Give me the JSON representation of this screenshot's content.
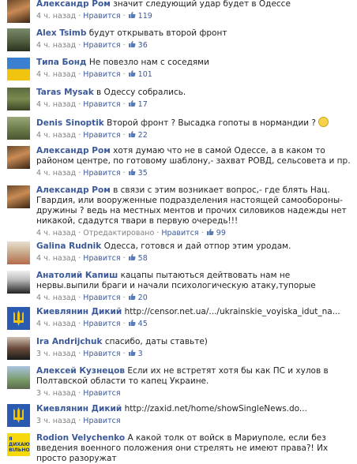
{
  "comments": [
    {
      "name": "Александр Ром",
      "text": "значит следующий удар будет в Одессе",
      "time": "4 ч. назад",
      "like": "Нравится",
      "count": "119"
    },
    {
      "name": "Alex Tsimb",
      "text": "будут открывать второй фронт",
      "time": "4 ч. назад",
      "like": "Нравится",
      "count": "36"
    },
    {
      "name": "Типа Бонд",
      "text": "Не повезло нам с соседями",
      "time": "4 ч. назад",
      "like": "Нравится",
      "count": "101"
    },
    {
      "name": "Taras Mysak",
      "text": "в Одессу собрались.",
      "time": "4 ч. назад",
      "like": "Нравится",
      "count": "17"
    },
    {
      "name": "Denis Sinoptik",
      "text": "Второй фронт ? Высадка гопоты в нормандии ?",
      "time": "4 ч. назад",
      "like": "Нравится",
      "count": "22"
    },
    {
      "name": "Александр Ром",
      "text": "хотя думаю что не в самой Одессе, а в каком то районом центре, по готовому шаблону,- захват РОВД, сельсовета и пр.",
      "time": "4 ч. назад",
      "like": "Нравится",
      "count": "35"
    },
    {
      "name": "Александр Ром",
      "text": "в связи с этим возникает вопрос,- где блять Нац. Гвардия, или вооруженные подразделения настоящей самообороны-дружины ? ведь на местных ментов и прочих силовиков надежды нет никакой, сдадутся твари в первую очередь!!!",
      "time": "4 ч. назад",
      "edited": "Отредактировано",
      "like": "Нравится",
      "count": "99"
    },
    {
      "name": "Galina Rudnik",
      "text": "Одесса, готовся и дай отпор этим уродам.",
      "time": "4 ч. назад",
      "like": "Нравится",
      "count": "58"
    },
    {
      "name": "Анатолий Капиш",
      "text": "кацапы пытаються дейтвовать нам не нервы.выпили браги и начали психологическую атаку,тупорые",
      "time": "4 ч. назад",
      "like": "Нравится",
      "count": "20"
    },
    {
      "name": "Киевлянин Дикий",
      "text": "http://censor.net.ua/.../ukrainskie_voyiska_idut_na...",
      "time": "4 ч. назад",
      "like": "Нравится",
      "count": "45"
    },
    {
      "name": "Ira Andrijchuk",
      "text": "спасибо, даты ставьте)",
      "time": "3 ч. назад",
      "like": "Нравится",
      "count": "3"
    },
    {
      "name": "Алексей Кузнецов",
      "text": "Если их не встретят хотя бы как ПС и хулов в Полтавской области то капец Украине.",
      "time": "3 ч. назад",
      "like": "Нравится",
      "count": ""
    },
    {
      "name": "Киевлянин Дикий",
      "text": "http://zaxid.net/home/showSingleNews.do...",
      "time": "3 ч. назад",
      "like": "Нравится",
      "count": ""
    },
    {
      "name": "Rodion Velychenko",
      "text": "А какой толк от войск в Мариуполе, если без введения военного положения они стрелять не имеют права?! Их просто разоружат",
      "time": "",
      "like": "",
      "count": ""
    }
  ],
  "avatar_badges": {
    "rodion": "Я ДИХАЮ ВІЛЬНО"
  },
  "separator": "·",
  "colors": {
    "link": "#3b5998",
    "meta": "#808080",
    "text": "#222222"
  }
}
